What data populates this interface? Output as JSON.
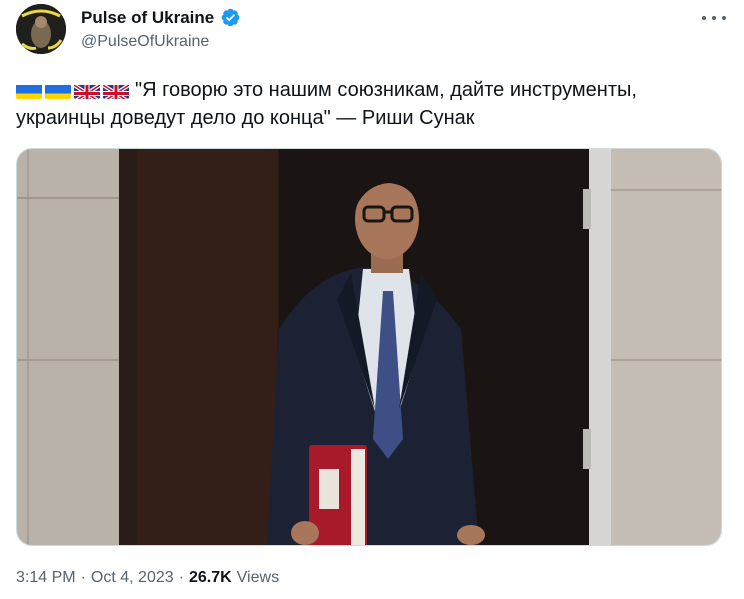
{
  "author": {
    "display_name": "Pulse of Ukraine",
    "handle": "@PulseOfUkraine",
    "avatar_text": "UKRAINE STANDS WITH YOU",
    "verified": true
  },
  "tweet": {
    "flags": [
      "ukraine-flag",
      "ukraine-flag",
      "uk-flag",
      "uk-flag"
    ],
    "text": "\"Я говорю это нашим союзникам, дайте инструменты, украинцы доведут дело до конца\" — Риши Сунак"
  },
  "meta": {
    "time": "3:14 PM",
    "separator1": "·",
    "date": "Oct 4, 2023",
    "separator2": "·",
    "views_count": "26.7K",
    "views_label": "Views"
  },
  "colors": {
    "verified": "#1d9bf0",
    "secondary_text": "#536471",
    "primary_text": "#0f1419"
  }
}
